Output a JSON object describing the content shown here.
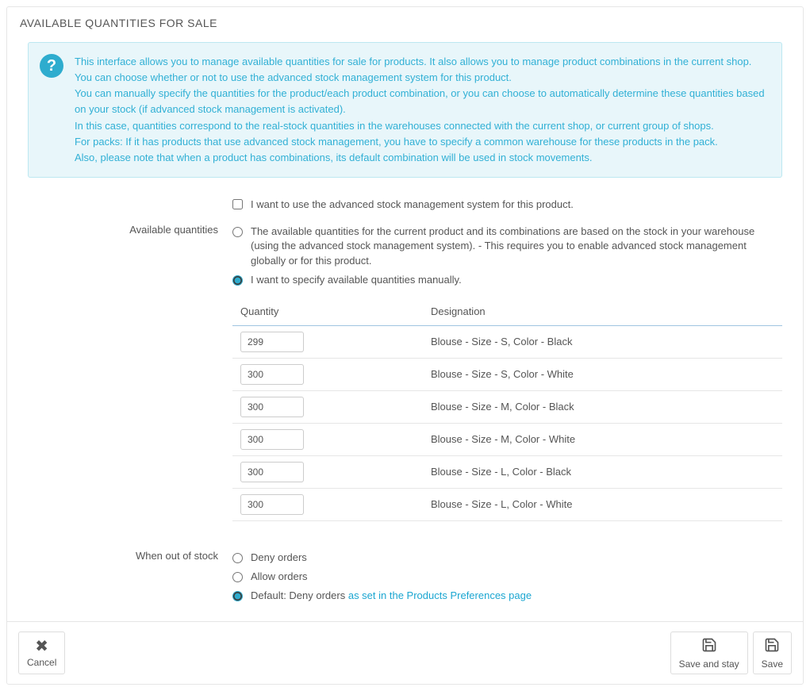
{
  "heading": "AVAILABLE QUANTITIES FOR SALE",
  "info": {
    "lines": [
      "This interface allows you to manage available quantities for sale for products. It also allows you to manage product combinations in the current shop.",
      "You can choose whether or not to use the advanced stock management system for this product.",
      "You can manually specify the quantities for the product/each product combination, or you can choose to automatically determine these quantities based on your stock (if advanced stock management is activated).",
      "In this case, quantities correspond to the real-stock quantities in the warehouses connected with the current shop, or current group of shops.",
      "For packs: If it has products that use advanced stock management, you have to specify a common warehouse for these products in the pack.",
      "Also, please note that when a product has combinations, its default combination will be used in stock movements."
    ]
  },
  "checkbox_asm": {
    "label": "I want to use the advanced stock management system for this product.",
    "checked": false
  },
  "available_qty": {
    "label": "Available quantities",
    "options": [
      {
        "text": "The available quantities for the current product and its combinations are based on the stock in your warehouse (using the advanced stock management system).  - This requires you to enable advanced stock management globally or for this product.",
        "selected": false
      },
      {
        "text": "I want to specify available quantities manually.",
        "selected": true
      }
    ]
  },
  "table": {
    "headers": {
      "qty": "Quantity",
      "designation": "Designation"
    },
    "rows": [
      {
        "qty": "299",
        "designation": "Blouse - Size - S, Color - Black"
      },
      {
        "qty": "300",
        "designation": "Blouse - Size - S, Color - White"
      },
      {
        "qty": "300",
        "designation": "Blouse - Size - M, Color - Black"
      },
      {
        "qty": "300",
        "designation": "Blouse - Size - M, Color - White"
      },
      {
        "qty": "300",
        "designation": "Blouse - Size - L, Color - Black"
      },
      {
        "qty": "300",
        "designation": "Blouse - Size - L, Color - White"
      }
    ]
  },
  "out_of_stock": {
    "label": "When out of stock",
    "options": [
      {
        "text": "Deny orders",
        "selected": false
      },
      {
        "text": "Allow orders",
        "selected": false
      },
      {
        "text_prefix": "Default: Deny orders ",
        "link_text": "as set in the Products Preferences page",
        "selected": true
      }
    ]
  },
  "buttons": {
    "cancel": "Cancel",
    "save_stay": "Save and stay",
    "save": "Save"
  }
}
